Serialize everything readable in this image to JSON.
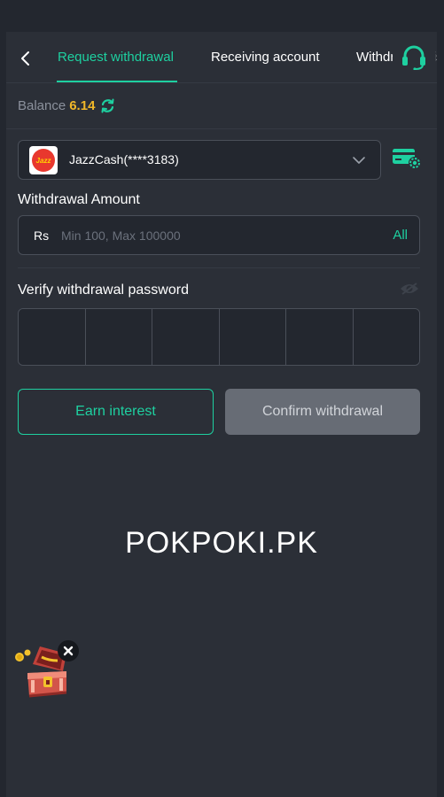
{
  "header": {
    "tabs": [
      {
        "label": "Request withdrawal",
        "active": true
      },
      {
        "label": "Receiving account",
        "active": false
      },
      {
        "label": "Withdrawal history",
        "active": false
      }
    ],
    "back_icon": "chevron-left-icon",
    "support_icon": "headset-icon"
  },
  "balance": {
    "label": "Balance",
    "value": "6.14",
    "refresh_icon": "refresh-icon"
  },
  "account": {
    "name": "JazzCash(****3183)",
    "logo_text": "Jazz"
  },
  "amount": {
    "label": "Withdrawal Amount",
    "currency": "Rs",
    "placeholder": "Min 100, Max 100000",
    "all_label": "All"
  },
  "password": {
    "label": "Verify withdrawal password",
    "cells": 6
  },
  "buttons": {
    "earn_label": "Earn interest",
    "confirm_label": "Confirm withdrawal"
  },
  "watermark": "POKPOKI.PK",
  "colors": {
    "accent": "#1ed0a0",
    "balance": "#f0b729",
    "background": "#23272f",
    "panel": "#2b2f37"
  }
}
